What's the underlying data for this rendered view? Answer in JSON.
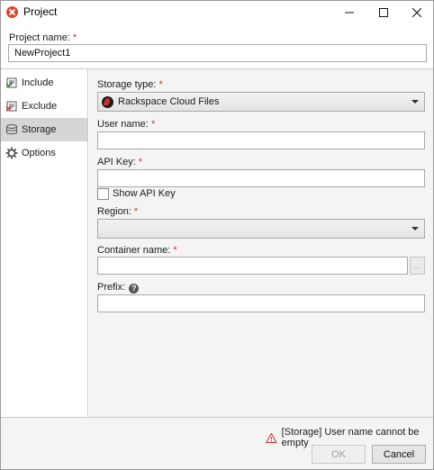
{
  "window": {
    "title": "Project",
    "controls": {
      "minimize": "—",
      "maximize": "☐",
      "close": "✕"
    }
  },
  "project": {
    "name_label": "Project name:",
    "name_value": "NewProject1",
    "required_mark": "*"
  },
  "sidebar": {
    "items": [
      {
        "label": "Include",
        "icon": "include-icon",
        "selected": false
      },
      {
        "label": "Exclude",
        "icon": "exclude-icon",
        "selected": false
      },
      {
        "label": "Storage",
        "icon": "storage-icon",
        "selected": true
      },
      {
        "label": "Options",
        "icon": "gear-icon",
        "selected": false
      }
    ]
  },
  "storage": {
    "type_label": "Storage type:",
    "type_value": "Rackspace Cloud Files",
    "username_label": "User name:",
    "username_value": "",
    "apikey_label": "API Key:",
    "apikey_value": "",
    "show_apikey_label": "Show API Key",
    "show_apikey_checked": false,
    "region_label": "Region:",
    "region_value": "",
    "container_label": "Container name:",
    "container_value": "",
    "browse_label": "...",
    "prefix_label": "Prefix:",
    "prefix_value": "",
    "help_glyph": "?"
  },
  "footer": {
    "warning_text": "[Storage] User name cannot be empty",
    "ok_label": "OK",
    "cancel_label": "Cancel"
  },
  "colors": {
    "required": "#d32f2f",
    "warning": "#d32f2f",
    "selected_nav": "#d6d6d6"
  }
}
